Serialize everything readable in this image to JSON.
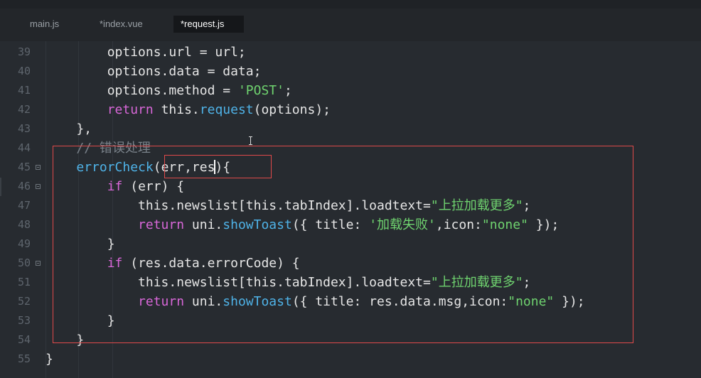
{
  "tabs": [
    {
      "label": "main.js",
      "active": false
    },
    {
      "label": "*index.vue",
      "active": false
    },
    {
      "label": "*request.js",
      "active": true
    }
  ],
  "lines": [
    {
      "num": "39",
      "indent": "        ",
      "tokens": [
        {
          "t": "options.url = url;",
          "c": "plain"
        }
      ]
    },
    {
      "num": "40",
      "indent": "        ",
      "tokens": [
        {
          "t": "options.data = data;",
          "c": "plain"
        }
      ]
    },
    {
      "num": "41",
      "indent": "        ",
      "tokens": [
        {
          "t": "options.method = ",
          "c": "plain"
        },
        {
          "t": "'POST'",
          "c": "str"
        },
        {
          "t": ";",
          "c": "plain"
        }
      ]
    },
    {
      "num": "42",
      "indent": "        ",
      "tokens": [
        {
          "t": "return",
          "c": "kw"
        },
        {
          "t": " this.",
          "c": "plain"
        },
        {
          "t": "request",
          "c": "fn"
        },
        {
          "t": "(options);",
          "c": "plain"
        }
      ]
    },
    {
      "num": "43",
      "indent": "    ",
      "tokens": [
        {
          "t": "},",
          "c": "plain"
        }
      ]
    },
    {
      "num": "44",
      "indent": "    ",
      "tokens": [
        {
          "t": "// 错误处理",
          "c": "cm"
        }
      ]
    },
    {
      "num": "45",
      "indent": "    ",
      "fold": true,
      "tokens": [
        {
          "t": "errorCheck",
          "c": "fn"
        },
        {
          "t": "(err,res",
          "c": "plain"
        },
        {
          "t": "",
          "c": "caret"
        },
        {
          "t": "){",
          "c": "plain"
        }
      ]
    },
    {
      "num": "46",
      "indent": "        ",
      "fold": true,
      "tokens": [
        {
          "t": "if",
          "c": "kw"
        },
        {
          "t": " (err) {",
          "c": "plain"
        }
      ]
    },
    {
      "num": "47",
      "indent": "            ",
      "tokens": [
        {
          "t": "this.newslist[this.tabIndex].loadtext=",
          "c": "plain"
        },
        {
          "t": "\"上拉加载更多\"",
          "c": "str"
        },
        {
          "t": ";",
          "c": "plain"
        }
      ]
    },
    {
      "num": "48",
      "indent": "            ",
      "tokens": [
        {
          "t": "return",
          "c": "kw"
        },
        {
          "t": " uni.",
          "c": "plain"
        },
        {
          "t": "showToast",
          "c": "fn"
        },
        {
          "t": "({ title: ",
          "c": "plain"
        },
        {
          "t": "'加载失败'",
          "c": "str"
        },
        {
          "t": ",icon:",
          "c": "plain"
        },
        {
          "t": "\"none\"",
          "c": "str"
        },
        {
          "t": " });",
          "c": "plain"
        }
      ]
    },
    {
      "num": "49",
      "indent": "        ",
      "tokens": [
        {
          "t": "}",
          "c": "plain"
        }
      ]
    },
    {
      "num": "50",
      "indent": "        ",
      "fold": true,
      "tokens": [
        {
          "t": "if",
          "c": "kw"
        },
        {
          "t": " (res.data.errorCode) {",
          "c": "plain"
        }
      ]
    },
    {
      "num": "51",
      "indent": "            ",
      "tokens": [
        {
          "t": "this.newslist[this.tabIndex].loadtext=",
          "c": "plain"
        },
        {
          "t": "\"上拉加载更多\"",
          "c": "str"
        },
        {
          "t": ";",
          "c": "plain"
        }
      ]
    },
    {
      "num": "52",
      "indent": "            ",
      "tokens": [
        {
          "t": "return",
          "c": "kw"
        },
        {
          "t": " uni.",
          "c": "plain"
        },
        {
          "t": "showToast",
          "c": "fn"
        },
        {
          "t": "({ title: res.data.msg,icon:",
          "c": "plain"
        },
        {
          "t": "\"none\"",
          "c": "str"
        },
        {
          "t": " });",
          "c": "plain"
        }
      ]
    },
    {
      "num": "53",
      "indent": "        ",
      "tokens": [
        {
          "t": "}",
          "c": "plain"
        }
      ]
    },
    {
      "num": "54",
      "indent": "    ",
      "tokens": [
        {
          "t": "}",
          "c": "plain"
        }
      ]
    },
    {
      "num": "55",
      "indent": "",
      "tokens": [
        {
          "t": "}",
          "c": "plain"
        }
      ]
    }
  ],
  "colors": {
    "keyword": "#d867d8",
    "function": "#4fb3e8",
    "string": "#6fd36f",
    "comment": "#7a828a",
    "highlight_box": "#e04a4a"
  }
}
